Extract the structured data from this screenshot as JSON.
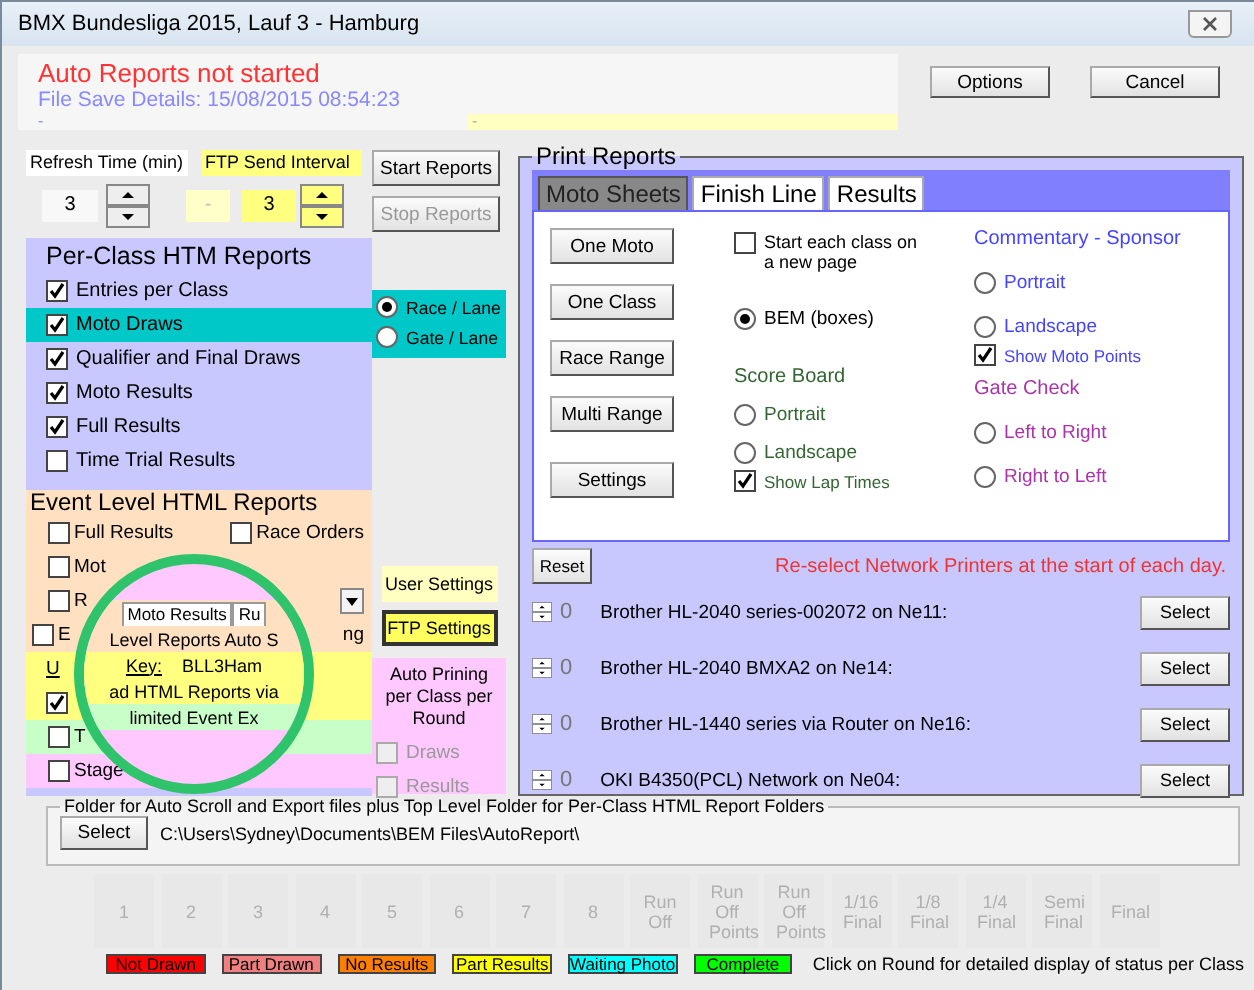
{
  "window": {
    "title": "BMX Bundesliga 2015, Lauf 3 - Hamburg"
  },
  "status": {
    "message": "Auto Reports not started",
    "file_save": "File Save Details: 15/08/2015 08:54:23",
    "line": "-",
    "note": "-"
  },
  "header_buttons": [
    {
      "label": "Options"
    },
    {
      "label": "Cancel"
    }
  ],
  "refresh": {
    "label": "Refresh Time (min)",
    "value": "3"
  },
  "ftp_interval": {
    "label": "FTP Send Interval",
    "value_1": "-",
    "value_2": "3"
  },
  "report_buttons": [
    {
      "label": "Start Reports",
      "disabled": false
    },
    {
      "label": "Stop Reports",
      "disabled": true
    }
  ],
  "per_class": {
    "title": "Per-Class HTM Reports",
    "items": [
      {
        "label": "Entries per Class",
        "checked": true,
        "selected": false
      },
      {
        "label": "Moto Draws",
        "checked": true,
        "selected": true
      },
      {
        "label": "Qualifier and Final Draws",
        "checked": true,
        "selected": false
      },
      {
        "label": "Moto Results",
        "checked": true,
        "selected": false
      },
      {
        "label": "Full Results",
        "checked": true,
        "selected": false
      },
      {
        "label": "Time Trial Results",
        "checked": false,
        "selected": false
      }
    ]
  },
  "lane_options": [
    {
      "label": "Race / Lane",
      "selected": true
    },
    {
      "label": "Gate / Lane",
      "selected": false
    }
  ],
  "event_level": {
    "title": "Event Level HTML Reports",
    "rows": [
      {
        "items": [
          {
            "kind": "checkbox",
            "label": "Full Results",
            "checked": false
          },
          {
            "kind": "checkbox",
            "label": "Race Orders",
            "checked": false
          }
        ]
      },
      {
        "items": [
          {
            "kind": "checkbox",
            "label": "Mot",
            "checked": false
          }
        ]
      },
      {
        "items": [
          {
            "kind": "checkbox",
            "label": "R",
            "checked": false
          },
          {
            "kind": "dropdown"
          }
        ]
      },
      {
        "items": [
          {
            "kind": "checkbox",
            "label": "E",
            "checked": false
          },
          {
            "kind": "text",
            "label": "ng"
          }
        ]
      },
      {
        "items": [
          {
            "kind": "text",
            "label": "U"
          }
        ]
      },
      {
        "items": [
          {
            "kind": "checkbox",
            "checked": true
          }
        ]
      },
      {
        "items": [
          {
            "kind": "checkbox",
            "label": "T",
            "checked": false
          }
        ]
      },
      {
        "items": [
          {
            "kind": "checkbox",
            "label": "Stage",
            "checked": false
          }
        ]
      }
    ]
  },
  "magnifier": {
    "tabs": [
      "Moto Results",
      "Ru"
    ],
    "dropdown": "Level Reports Auto S",
    "key_label": "Key:",
    "key_value": "BLL3Ham",
    "upload": "ad HTML Reports via",
    "limited": "limited Event Ex"
  },
  "user_settings": "User Settings",
  "ftp_settings": "FTP Settings",
  "auto_printing": {
    "title": "Auto Prining per Class per Round",
    "items": [
      {
        "label": "Draws",
        "checked": false,
        "disabled": true
      },
      {
        "label": "Results",
        "checked": false,
        "disabled": true
      }
    ]
  },
  "print_reports": {
    "title": "Print Reports",
    "tabs": [
      {
        "label": "Moto Sheets",
        "selected": true
      },
      {
        "label": "Finish Line",
        "selected": false
      },
      {
        "label": "Results",
        "selected": false
      }
    ],
    "buttons": [
      "One Moto",
      "One Class",
      "Race Range",
      "Multi Range",
      "Settings"
    ],
    "start_each_class": {
      "label": "Start each class on a new page",
      "checked": false
    },
    "bem": {
      "label": "BEM (boxes)",
      "selected": true
    },
    "score_board": {
      "title": "Score Board",
      "options": [
        {
          "label": "Portrait",
          "selected": false
        },
        {
          "label": "Landscape",
          "selected": false
        }
      ],
      "show_lap_times": {
        "label": "Show Lap Times",
        "checked": true
      }
    },
    "commentary": {
      "title": "Commentary - Sponsor",
      "options": [
        {
          "label": "Portrait",
          "selected": false
        },
        {
          "label": "Landscape",
          "selected": false
        }
      ],
      "show_moto_points": {
        "label": "Show Moto Points",
        "checked": true
      }
    },
    "gate_check": {
      "title": "Gate Check",
      "options": [
        {
          "label": "Left to Right",
          "selected": false
        },
        {
          "label": "Right to Left",
          "selected": false
        }
      ]
    }
  },
  "printers": {
    "reset": "Reset",
    "notice": "Re-select Network Printers at the start of each day.",
    "list": [
      {
        "count": "0",
        "name": "Brother HL-2040 series-002072 on Ne11:",
        "button": "Select"
      },
      {
        "count": "0",
        "name": "Brother HL-2040 BMXA2 on Ne14:",
        "button": "Select"
      },
      {
        "count": "0",
        "name": "Brother HL-1440 series via Router on Ne16:",
        "button": "Select"
      },
      {
        "count": "0",
        "name": "OKI B4350(PCL) Network on Ne04:",
        "button": "Select"
      }
    ]
  },
  "folder": {
    "title": "Folder for Auto Scroll and Export files plus Top Level Folder for Per-Class HTML Report Folders",
    "button": "Select",
    "path": "C:\\Users\\Sydney\\Documents\\BEM Files\\AutoReport\\"
  },
  "rounds": [
    "1",
    "2",
    "3",
    "4",
    "5",
    "6",
    "7",
    "8",
    "Run Off",
    "Run Off Points",
    "Run Off Points",
    "1/16 Final",
    "1/8 Final",
    "1/4 Final",
    "Semi Final",
    "Final"
  ],
  "legend": [
    {
      "label": "Not Drawn",
      "color": "#ff0000"
    },
    {
      "label": "Part Drawn",
      "color": "#f08080"
    },
    {
      "label": "No Results",
      "color": "#ff8000"
    },
    {
      "label": "Part Results",
      "color": "#ffff00"
    },
    {
      "label": "Waiting Photo",
      "color": "#00ffff"
    },
    {
      "label": "Complete",
      "color": "#00ff00"
    }
  ],
  "legend_hint": "Click on Round for detailed display of status per Class"
}
